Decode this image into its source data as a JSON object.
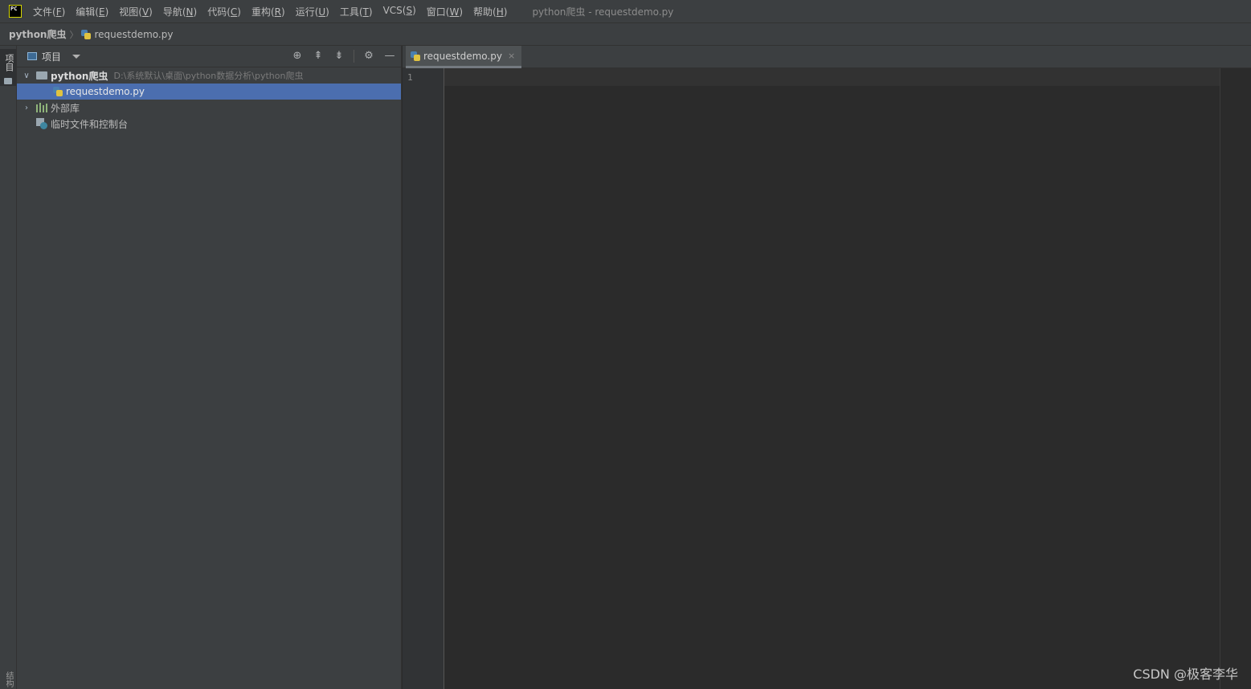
{
  "app": {
    "logo_text": "PC",
    "window_title": "python爬虫 - requestdemo.py"
  },
  "menu": [
    {
      "label": "文件(",
      "key": "F",
      "close": ")"
    },
    {
      "label": "编辑(",
      "key": "E",
      "close": ")"
    },
    {
      "label": "视图(",
      "key": "V",
      "close": ")"
    },
    {
      "label": "导航(",
      "key": "N",
      "close": ")"
    },
    {
      "label": "代码(",
      "key": "C",
      "close": ")"
    },
    {
      "label": "重构(",
      "key": "R",
      "close": ")"
    },
    {
      "label": "运行(",
      "key": "U",
      "close": ")"
    },
    {
      "label": "工具(",
      "key": "T",
      "close": ")"
    },
    {
      "label": "VCS(",
      "key": "S",
      "close": ")"
    },
    {
      "label": "窗口(",
      "key": "W",
      "close": ")"
    },
    {
      "label": "帮助(",
      "key": "H",
      "close": ")"
    }
  ],
  "breadcrumb": {
    "root": "python爬虫",
    "file": "requestdemo.py"
  },
  "left_strip": {
    "project_tab": "项目",
    "structure_tab": "结构"
  },
  "project_panel": {
    "title": "项目",
    "tools": [
      "locate-icon",
      "expand-all-icon",
      "collapse-all-icon",
      "gear-icon",
      "minimize-icon"
    ],
    "tree": {
      "root_name": "python爬虫",
      "root_path": "D:\\系统默认\\桌面\\python数据分析\\python爬虫",
      "file": "requestdemo.py",
      "external_libs": "外部库",
      "scratches": "临时文件和控制台"
    }
  },
  "editor": {
    "tab_label": "requestdemo.py",
    "tab_close": "×",
    "line_numbers": [
      "1"
    ]
  },
  "watermark": "CSDN @极客李华"
}
